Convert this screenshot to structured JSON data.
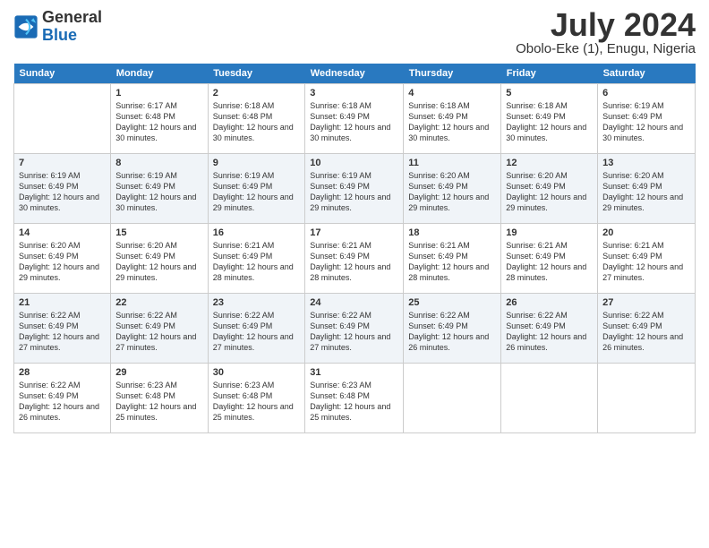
{
  "logo": {
    "line1": "General",
    "line2": "Blue"
  },
  "title": "July 2024",
  "location": "Obolo-Eke (1), Enugu, Nigeria",
  "header": {
    "days": [
      "Sunday",
      "Monday",
      "Tuesday",
      "Wednesday",
      "Thursday",
      "Friday",
      "Saturday"
    ]
  },
  "weeks": [
    [
      {
        "day": "",
        "sunrise": "",
        "sunset": "",
        "daylight": ""
      },
      {
        "day": "1",
        "sunrise": "Sunrise: 6:17 AM",
        "sunset": "Sunset: 6:48 PM",
        "daylight": "Daylight: 12 hours and 30 minutes."
      },
      {
        "day": "2",
        "sunrise": "Sunrise: 6:18 AM",
        "sunset": "Sunset: 6:48 PM",
        "daylight": "Daylight: 12 hours and 30 minutes."
      },
      {
        "day": "3",
        "sunrise": "Sunrise: 6:18 AM",
        "sunset": "Sunset: 6:49 PM",
        "daylight": "Daylight: 12 hours and 30 minutes."
      },
      {
        "day": "4",
        "sunrise": "Sunrise: 6:18 AM",
        "sunset": "Sunset: 6:49 PM",
        "daylight": "Daylight: 12 hours and 30 minutes."
      },
      {
        "day": "5",
        "sunrise": "Sunrise: 6:18 AM",
        "sunset": "Sunset: 6:49 PM",
        "daylight": "Daylight: 12 hours and 30 minutes."
      },
      {
        "day": "6",
        "sunrise": "Sunrise: 6:19 AM",
        "sunset": "Sunset: 6:49 PM",
        "daylight": "Daylight: 12 hours and 30 minutes."
      }
    ],
    [
      {
        "day": "7",
        "sunrise": "Sunrise: 6:19 AM",
        "sunset": "Sunset: 6:49 PM",
        "daylight": "Daylight: 12 hours and 30 minutes."
      },
      {
        "day": "8",
        "sunrise": "Sunrise: 6:19 AM",
        "sunset": "Sunset: 6:49 PM",
        "daylight": "Daylight: 12 hours and 30 minutes."
      },
      {
        "day": "9",
        "sunrise": "Sunrise: 6:19 AM",
        "sunset": "Sunset: 6:49 PM",
        "daylight": "Daylight: 12 hours and 29 minutes."
      },
      {
        "day": "10",
        "sunrise": "Sunrise: 6:19 AM",
        "sunset": "Sunset: 6:49 PM",
        "daylight": "Daylight: 12 hours and 29 minutes."
      },
      {
        "day": "11",
        "sunrise": "Sunrise: 6:20 AM",
        "sunset": "Sunset: 6:49 PM",
        "daylight": "Daylight: 12 hours and 29 minutes."
      },
      {
        "day": "12",
        "sunrise": "Sunrise: 6:20 AM",
        "sunset": "Sunset: 6:49 PM",
        "daylight": "Daylight: 12 hours and 29 minutes."
      },
      {
        "day": "13",
        "sunrise": "Sunrise: 6:20 AM",
        "sunset": "Sunset: 6:49 PM",
        "daylight": "Daylight: 12 hours and 29 minutes."
      }
    ],
    [
      {
        "day": "14",
        "sunrise": "Sunrise: 6:20 AM",
        "sunset": "Sunset: 6:49 PM",
        "daylight": "Daylight: 12 hours and 29 minutes."
      },
      {
        "day": "15",
        "sunrise": "Sunrise: 6:20 AM",
        "sunset": "Sunset: 6:49 PM",
        "daylight": "Daylight: 12 hours and 29 minutes."
      },
      {
        "day": "16",
        "sunrise": "Sunrise: 6:21 AM",
        "sunset": "Sunset: 6:49 PM",
        "daylight": "Daylight: 12 hours and 28 minutes."
      },
      {
        "day": "17",
        "sunrise": "Sunrise: 6:21 AM",
        "sunset": "Sunset: 6:49 PM",
        "daylight": "Daylight: 12 hours and 28 minutes."
      },
      {
        "day": "18",
        "sunrise": "Sunrise: 6:21 AM",
        "sunset": "Sunset: 6:49 PM",
        "daylight": "Daylight: 12 hours and 28 minutes."
      },
      {
        "day": "19",
        "sunrise": "Sunrise: 6:21 AM",
        "sunset": "Sunset: 6:49 PM",
        "daylight": "Daylight: 12 hours and 28 minutes."
      },
      {
        "day": "20",
        "sunrise": "Sunrise: 6:21 AM",
        "sunset": "Sunset: 6:49 PM",
        "daylight": "Daylight: 12 hours and 27 minutes."
      }
    ],
    [
      {
        "day": "21",
        "sunrise": "Sunrise: 6:22 AM",
        "sunset": "Sunset: 6:49 PM",
        "daylight": "Daylight: 12 hours and 27 minutes."
      },
      {
        "day": "22",
        "sunrise": "Sunrise: 6:22 AM",
        "sunset": "Sunset: 6:49 PM",
        "daylight": "Daylight: 12 hours and 27 minutes."
      },
      {
        "day": "23",
        "sunrise": "Sunrise: 6:22 AM",
        "sunset": "Sunset: 6:49 PM",
        "daylight": "Daylight: 12 hours and 27 minutes."
      },
      {
        "day": "24",
        "sunrise": "Sunrise: 6:22 AM",
        "sunset": "Sunset: 6:49 PM",
        "daylight": "Daylight: 12 hours and 27 minutes."
      },
      {
        "day": "25",
        "sunrise": "Sunrise: 6:22 AM",
        "sunset": "Sunset: 6:49 PM",
        "daylight": "Daylight: 12 hours and 26 minutes."
      },
      {
        "day": "26",
        "sunrise": "Sunrise: 6:22 AM",
        "sunset": "Sunset: 6:49 PM",
        "daylight": "Daylight: 12 hours and 26 minutes."
      },
      {
        "day": "27",
        "sunrise": "Sunrise: 6:22 AM",
        "sunset": "Sunset: 6:49 PM",
        "daylight": "Daylight: 12 hours and 26 minutes."
      }
    ],
    [
      {
        "day": "28",
        "sunrise": "Sunrise: 6:22 AM",
        "sunset": "Sunset: 6:49 PM",
        "daylight": "Daylight: 12 hours and 26 minutes."
      },
      {
        "day": "29",
        "sunrise": "Sunrise: 6:23 AM",
        "sunset": "Sunset: 6:48 PM",
        "daylight": "Daylight: 12 hours and 25 minutes."
      },
      {
        "day": "30",
        "sunrise": "Sunrise: 6:23 AM",
        "sunset": "Sunset: 6:48 PM",
        "daylight": "Daylight: 12 hours and 25 minutes."
      },
      {
        "day": "31",
        "sunrise": "Sunrise: 6:23 AM",
        "sunset": "Sunset: 6:48 PM",
        "daylight": "Daylight: 12 hours and 25 minutes."
      },
      {
        "day": "",
        "sunrise": "",
        "sunset": "",
        "daylight": ""
      },
      {
        "day": "",
        "sunrise": "",
        "sunset": "",
        "daylight": ""
      },
      {
        "day": "",
        "sunrise": "",
        "sunset": "",
        "daylight": ""
      }
    ]
  ]
}
